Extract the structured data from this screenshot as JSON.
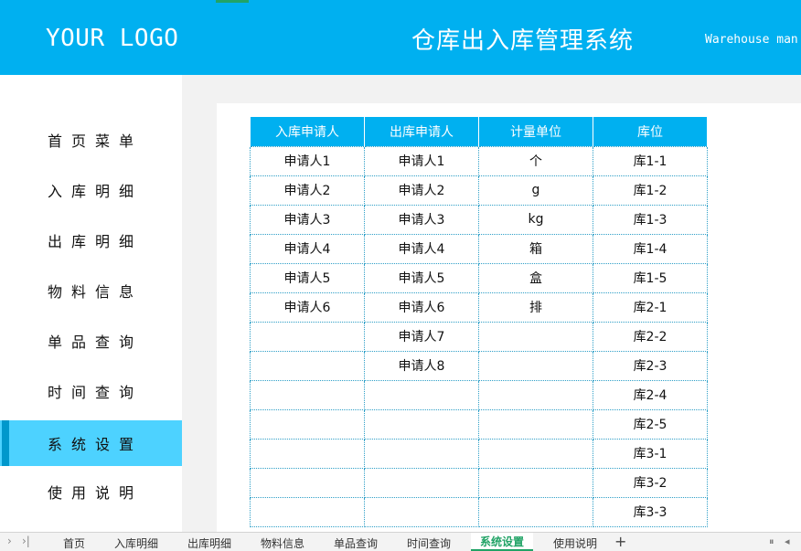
{
  "header": {
    "logo": "YOUR LOGO",
    "title": "仓库出入库管理系统",
    "subtitle": "Warehouse man"
  },
  "sidebar": {
    "items": [
      {
        "label": "首页菜单",
        "active": false
      },
      {
        "label": "入库明细",
        "active": false
      },
      {
        "label": "出库明细",
        "active": false
      },
      {
        "label": "物料信息",
        "active": false
      },
      {
        "label": "单品查询",
        "active": false
      },
      {
        "label": "时间查询",
        "active": false
      },
      {
        "label": "系统设置",
        "active": true
      },
      {
        "label": "使用说明",
        "active": false
      }
    ]
  },
  "table": {
    "headers": [
      "入库申请人",
      "出库申请人",
      "计量单位",
      "库位"
    ],
    "rows": [
      [
        "申请人1",
        "申请人1",
        "个",
        "库1-1"
      ],
      [
        "申请人2",
        "申请人2",
        "g",
        "库1-2"
      ],
      [
        "申请人3",
        "申请人3",
        "kg",
        "库1-3"
      ],
      [
        "申请人4",
        "申请人4",
        "箱",
        "库1-4"
      ],
      [
        "申请人5",
        "申请人5",
        "盒",
        "库1-5"
      ],
      [
        "申请人6",
        "申请人6",
        "排",
        "库2-1"
      ],
      [
        "",
        "申请人7",
        "",
        "库2-2"
      ],
      [
        "",
        "申请人8",
        "",
        "库2-3"
      ],
      [
        "",
        "",
        "",
        "库2-4"
      ],
      [
        "",
        "",
        "",
        "库2-5"
      ],
      [
        "",
        "",
        "",
        "库3-1"
      ],
      [
        "",
        "",
        "",
        "库3-2"
      ],
      [
        "",
        "",
        "",
        "库3-3"
      ]
    ]
  },
  "sheet_tabs": {
    "tabs": [
      "首页",
      "入库明细",
      "出库明细",
      "物料信息",
      "单品查询",
      "时间查询",
      "系统设置",
      "使用说明"
    ],
    "active_index": 6,
    "add_symbol": "+",
    "first_arrow": "›",
    "last_arrow": "›|"
  },
  "colors": {
    "header_bg": "#00b0f0",
    "active_nav": "#4dd2ff",
    "active_tab": "#21a366"
  }
}
